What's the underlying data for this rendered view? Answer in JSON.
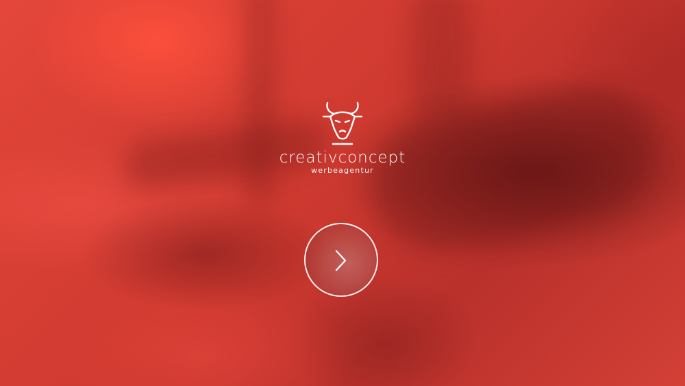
{
  "brand": {
    "name": "creativconcept",
    "tagline": "werbeagentur",
    "logo_icon": "bull-head-icon"
  },
  "hero": {
    "next_icon": "chevron-right-icon"
  },
  "colors": {
    "background": "#d23a30",
    "foreground": "#ffffff"
  }
}
